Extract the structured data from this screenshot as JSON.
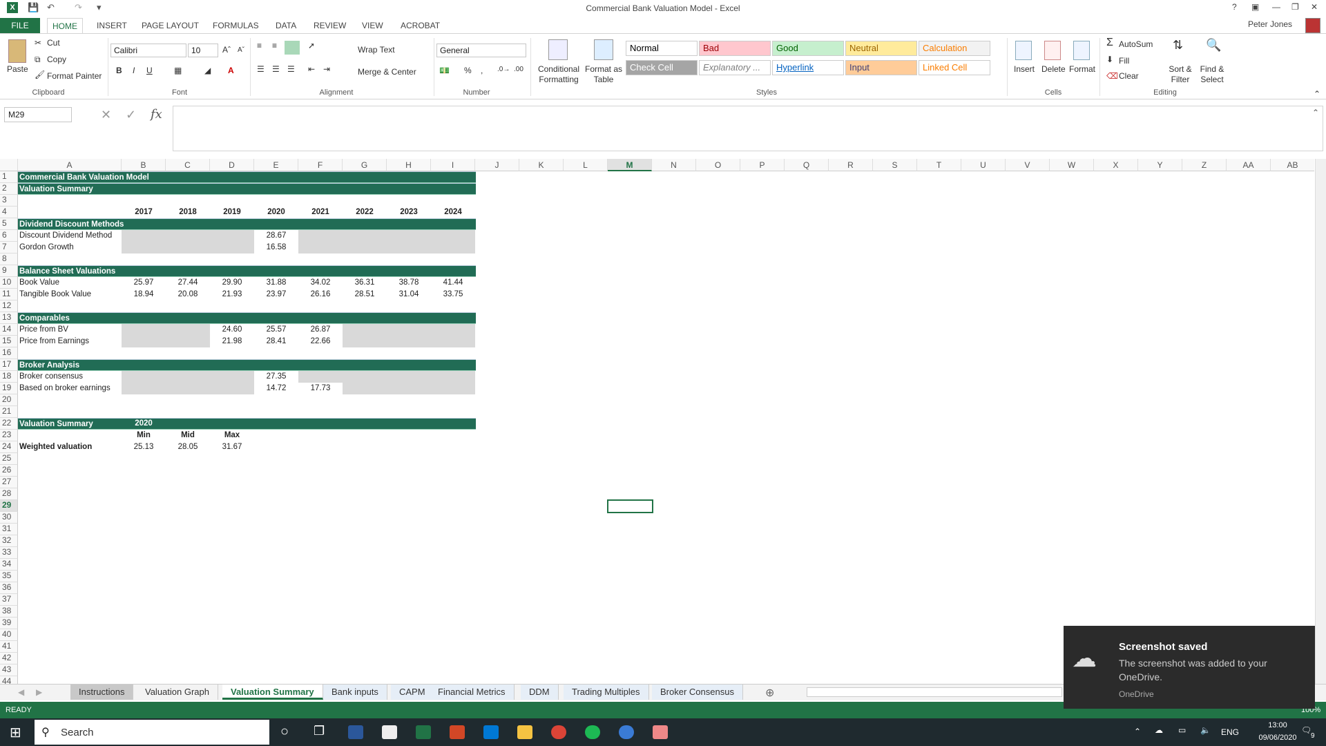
{
  "window": {
    "title": "Commercial Bank Valuation Model - Excel",
    "user": "Peter Jones",
    "help": "?"
  },
  "ribbon_tabs": [
    "FILE",
    "HOME",
    "INSERT",
    "PAGE LAYOUT",
    "FORMULAS",
    "DATA",
    "REVIEW",
    "VIEW",
    "ACROBAT"
  ],
  "clipboard": {
    "paste": "Paste",
    "cut": "Cut",
    "copy": "Copy",
    "format_painter": "Format Painter",
    "group": "Clipboard"
  },
  "font": {
    "name": "Calibri",
    "size": "10",
    "bold": "B",
    "italic": "I",
    "underline": "U",
    "group": "Font"
  },
  "alignment": {
    "wrap": "Wrap Text",
    "merge": "Merge & Center",
    "group": "Alignment"
  },
  "number": {
    "format": "General",
    "percent": "%",
    "group": "Number"
  },
  "styles": {
    "conditional": "Conditional Formatting",
    "table": "Format as Table",
    "group": "Styles",
    "cells": [
      {
        "label": "Normal",
        "bg": "#ffffff",
        "fg": "#000000"
      },
      {
        "label": "Bad",
        "bg": "#ffc7ce",
        "fg": "#9c0006"
      },
      {
        "label": "Good",
        "bg": "#c6efce",
        "fg": "#006100"
      },
      {
        "label": "Neutral",
        "bg": "#ffeb9c",
        "fg": "#9c6500"
      },
      {
        "label": "Calculation",
        "bg": "#f2f2f2",
        "fg": "#fa7d00"
      },
      {
        "label": "Check Cell",
        "bg": "#a5a5a5",
        "fg": "#ffffff"
      },
      {
        "label": "Explanatory ...",
        "bg": "#ffffff",
        "fg": "#7f7f7f"
      },
      {
        "label": "Hyperlink",
        "bg": "#ffffff",
        "fg": "#0563c1"
      },
      {
        "label": "Input",
        "bg": "#ffcc99",
        "fg": "#3f3f76"
      },
      {
        "label": "Linked Cell",
        "bg": "#ffffff",
        "fg": "#fa7d00"
      }
    ]
  },
  "cells_group": {
    "insert": "Insert",
    "delete": "Delete",
    "format": "Format",
    "group": "Cells"
  },
  "editing": {
    "autosum": "AutoSum",
    "fill": "Fill",
    "clear": "Clear",
    "sort": "Sort & Filter",
    "find": "Find & Select",
    "group": "Editing"
  },
  "namebox": "M29",
  "columns": [
    "A",
    "B",
    "C",
    "D",
    "E",
    "F",
    "G",
    "H",
    "I",
    "J",
    "K",
    "L",
    "M",
    "N",
    "O",
    "P",
    "Q",
    "R",
    "S",
    "T",
    "U",
    "V",
    "W",
    "X",
    "Y",
    "Z",
    "AA",
    "AB"
  ],
  "sheet": {
    "title": "Commercial Bank Valuation Model",
    "subtitle": "Valuation Summary",
    "years": [
      "2017",
      "2018",
      "2019",
      "2020",
      "2021",
      "2022",
      "2023",
      "2024"
    ],
    "ddm_header": "Dividend Discount Methods",
    "ddm": [
      {
        "label": "Discount Dividend Method",
        "e": "28.67"
      },
      {
        "label": "Gordon Growth",
        "e": "16.58"
      }
    ],
    "bs_header": "Balance Sheet Valuations",
    "bs": [
      {
        "label": "Book Value",
        "vals": [
          "25.97",
          "27.44",
          "29.90",
          "31.88",
          "34.02",
          "36.31",
          "38.78",
          "41.44"
        ]
      },
      {
        "label": "Tangible Book Value",
        "vals": [
          "18.94",
          "20.08",
          "21.93",
          "23.97",
          "26.16",
          "28.51",
          "31.04",
          "33.75"
        ]
      }
    ],
    "comp_header": "Comparables",
    "comp": [
      {
        "label": "Price from BV",
        "vals": [
          "24.60",
          "25.57",
          "26.87"
        ]
      },
      {
        "label": "Price from Earnings",
        "vals": [
          "21.98",
          "28.41",
          "22.66"
        ]
      }
    ],
    "broker_header": "Broker Analysis",
    "broker": [
      {
        "label": "Broker consensus",
        "e": "27.35"
      },
      {
        "label": "Based on broker earnings",
        "e": "14.72",
        "f": "17.73"
      }
    ],
    "vs_header": "Valuation Summary",
    "vs_year": "2020",
    "vs_cols": [
      "Min",
      "Mid",
      "Max"
    ],
    "weighted": {
      "label": "Weighted valuation",
      "vals": [
        "25.13",
        "28.05",
        "31.67"
      ]
    }
  },
  "sheet_tabs": [
    "Instructions",
    "Valuation Graph",
    "Valuation Summary",
    "Bank inputs",
    "CAPM",
    "Financial Metrics",
    "DDM",
    "Trading Multiples",
    "Broker Consensus"
  ],
  "status": "READY",
  "zoom": "100%",
  "taskbar": {
    "search": "Search",
    "lang": "ENG",
    "time": "13:00",
    "date": "09/06/2020",
    "notif": "9"
  },
  "toast": {
    "title": "Screenshot saved",
    "body": "The screenshot was added to your OneDrive.",
    "app": "OneDrive"
  }
}
